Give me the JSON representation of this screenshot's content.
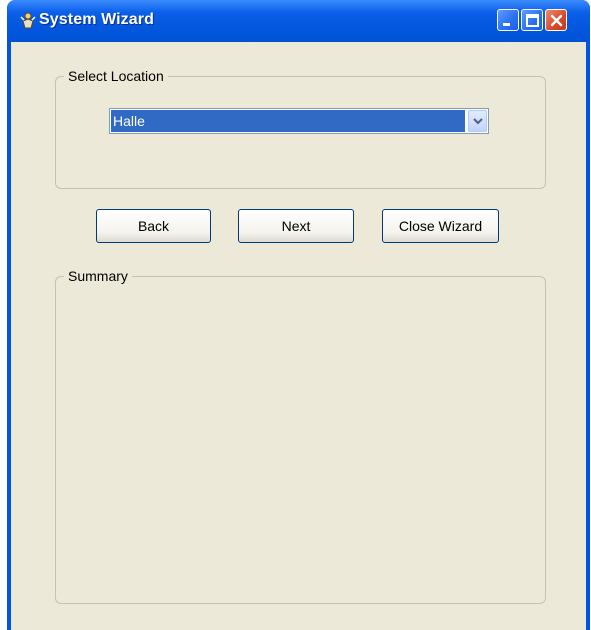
{
  "window": {
    "title": "System Wizard",
    "controls": {
      "minimize": "minimize-icon",
      "maximize": "maximize-icon",
      "close": "close-icon"
    }
  },
  "location_group": {
    "label": "Select Location",
    "selected_value": "Halle"
  },
  "buttons": {
    "back": "Back",
    "next": "Next",
    "close_wizard": "Close Wizard"
  },
  "summary_group": {
    "label": "Summary"
  },
  "colors": {
    "titlebar": "#0055e5",
    "client_background": "#ece9d8",
    "selection": "#316ac5"
  }
}
